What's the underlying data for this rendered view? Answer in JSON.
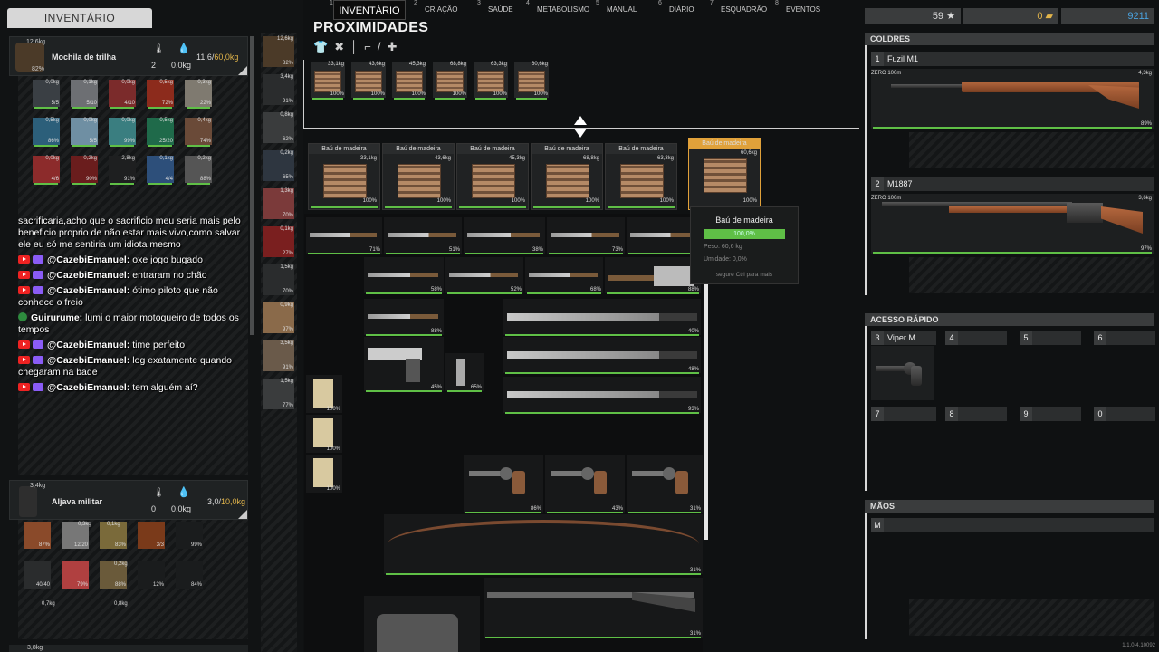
{
  "left": {
    "title": "INVENTÁRIO",
    "backpack": {
      "name": "Mochila de trilha",
      "weight": "12,6kg",
      "pct": "82%",
      "temp": "2",
      "water": "0,0kg",
      "cap_used": "11,6",
      "cap_total": "60,0kg"
    },
    "grid_weights": [
      "0,0kg",
      "0,1kg",
      "0,0kg",
      "0,5kg",
      "0,3kg",
      "0,5kg",
      "0,0kg",
      "0,0kg",
      "0,5kg",
      "0,4kg",
      "0,0kg",
      "0,2kg",
      "2,8kg",
      "0,1kg",
      "0,2kg"
    ],
    "grid_pcts": [
      "5/5",
      "5/10",
      "4/10",
      "72%",
      "22%",
      "86%",
      "5/5",
      "99%",
      "25/20",
      "74%",
      "4/6",
      "90%",
      "91%",
      "4/4",
      "88%"
    ],
    "quiver": {
      "name": "Aljava militar",
      "weight": "3,4kg",
      "temp": "0",
      "water": "0,0kg",
      "cap_used": "3,0",
      "cap_total": "10,0kg"
    },
    "quiver_weights": [
      "0,3kg",
      "0,1kg",
      "0,2kg",
      "0,7kg",
      "0,8kg"
    ],
    "quiver_pcts": [
      "87%",
      "12/20",
      "83%",
      "3/3",
      "99%",
      "40/40",
      "79%",
      "88%",
      "12%",
      "84%"
    ],
    "bottom_weight": "3,8kg",
    "equip_weights": [
      "12,6kg",
      "3,4kg",
      "0,8kg",
      "0,2kg",
      "1,3kg",
      "0,1kg",
      "1,5kg",
      "0,9kg",
      "3,5kg",
      "1,5kg"
    ],
    "equip_pcts": [
      "82%",
      "91%",
      "62%",
      "65%",
      "70%",
      "27%",
      "70%",
      "97%",
      "91%",
      "77%"
    ]
  },
  "chat": [
    {
      "type": "plain",
      "text": "sacrificaria,acho que o sacrificio meu seria mais pelo beneficio proprio de não estar mais vivo,como salvar ele eu só me sentiria um idiota mesmo"
    },
    {
      "type": "yt",
      "user": "@CazebiEmanuel:",
      "text": "oxe jogo bugado"
    },
    {
      "type": "yt",
      "user": "@CazebiEmanuel:",
      "text": "entraram no chão"
    },
    {
      "type": "yt",
      "user": "@CazebiEmanuel:",
      "text": "ótimo piloto que não conhece o freio"
    },
    {
      "type": "x",
      "user": "Guirurume:",
      "text": "lumi o maior motoqueiro de todos os tempos"
    },
    {
      "type": "yt",
      "user": "@CazebiEmanuel:",
      "text": "time perfeito"
    },
    {
      "type": "yt",
      "user": "@CazebiEmanuel:",
      "text": "log exatamente quando chegaram na bade"
    },
    {
      "type": "yt",
      "user": "@CazebiEmanuel:",
      "text": "tem alguém aí?"
    }
  ],
  "tabs": [
    {
      "num": "1",
      "label": "INVENTÁRIO"
    },
    {
      "num": "2",
      "label": "CRIAÇÃO"
    },
    {
      "num": "3",
      "label": "SAÚDE"
    },
    {
      "num": "4",
      "label": "METABOLISMO"
    },
    {
      "num": "5",
      "label": "MANUAL"
    },
    {
      "num": "6",
      "label": "DIÁRIO"
    },
    {
      "num": "7",
      "label": "ESQUADRÃO"
    },
    {
      "num": "8",
      "label": "EVENTOS"
    }
  ],
  "proximity": {
    "title": "PROXIMIDADES",
    "small_crates": [
      {
        "weight": "33,1kg",
        "pct": "100%"
      },
      {
        "weight": "43,6kg",
        "pct": "100%"
      },
      {
        "weight": "45,3kg",
        "pct": "100%"
      },
      {
        "weight": "68,8kg",
        "pct": "100%"
      },
      {
        "weight": "63,3kg",
        "pct": "100%"
      },
      {
        "weight": "60,6kg",
        "pct": "100%"
      }
    ],
    "crates": [
      {
        "label": "Baú de madeira",
        "weight": "33,1kg",
        "pct": "100%"
      },
      {
        "label": "Baú de madeira",
        "weight": "43,6kg",
        "pct": "100%"
      },
      {
        "label": "Baú de madeira",
        "weight": "45,3kg",
        "pct": "100%"
      },
      {
        "label": "Baú de madeira",
        "weight": "68,8kg",
        "pct": "100%"
      },
      {
        "label": "Baú de madeira",
        "weight": "63,3kg",
        "pct": "100%"
      },
      {
        "label": "Baú de madeira",
        "weight": "60,6kg",
        "pct": "100%"
      }
    ],
    "knife_pcts": [
      "71%",
      "51%",
      "38%",
      "73%",
      "63%",
      "58%",
      "52%",
      "68%",
      "88%",
      "88%",
      "40%",
      "45%",
      "65%",
      "48%",
      "93%",
      "86%",
      "43%",
      "31%"
    ],
    "paper_pcts": [
      "100%",
      "100%",
      "100%"
    ]
  },
  "tooltip": {
    "title": "Baú de madeira",
    "bar_text": "100,0%",
    "weight_label": "Peso:",
    "weight_value": "60,6 kg",
    "humidity_label": "Umidade:",
    "humidity_value": "0,0%",
    "hint": "segure Ctrl para mais"
  },
  "right": {
    "stars": "59",
    "gold": "0",
    "blue": "9211",
    "holsters_label": "COLDRES",
    "slot1": {
      "num": "1",
      "name": "Fuzil M1",
      "zero": "ZERO 100m",
      "weight": "4,3kg",
      "pct": "89%"
    },
    "slot2": {
      "num": "2",
      "name": "M1887",
      "zero": "ZERO 100m",
      "weight": "3,6kg",
      "pct": "97%"
    },
    "quick_label": "ACESSO RÁPIDO",
    "quick_slots": [
      {
        "num": "3",
        "name": "Viper M"
      },
      {
        "num": "4",
        "name": ""
      },
      {
        "num": "5",
        "name": ""
      },
      {
        "num": "6",
        "name": ""
      },
      {
        "num": "7",
        "name": ""
      },
      {
        "num": "8",
        "name": ""
      },
      {
        "num": "9",
        "name": ""
      },
      {
        "num": "0",
        "name": ""
      }
    ],
    "hands_label": "MÃOS",
    "hands_slot": "M",
    "version": "1.1.0.4.10092"
  },
  "colors": {
    "accent_gold": "#e1b44a",
    "health_green": "#5fbf46",
    "blue_currency": "#4aa3e0",
    "selected_orange": "#e0a13a"
  }
}
